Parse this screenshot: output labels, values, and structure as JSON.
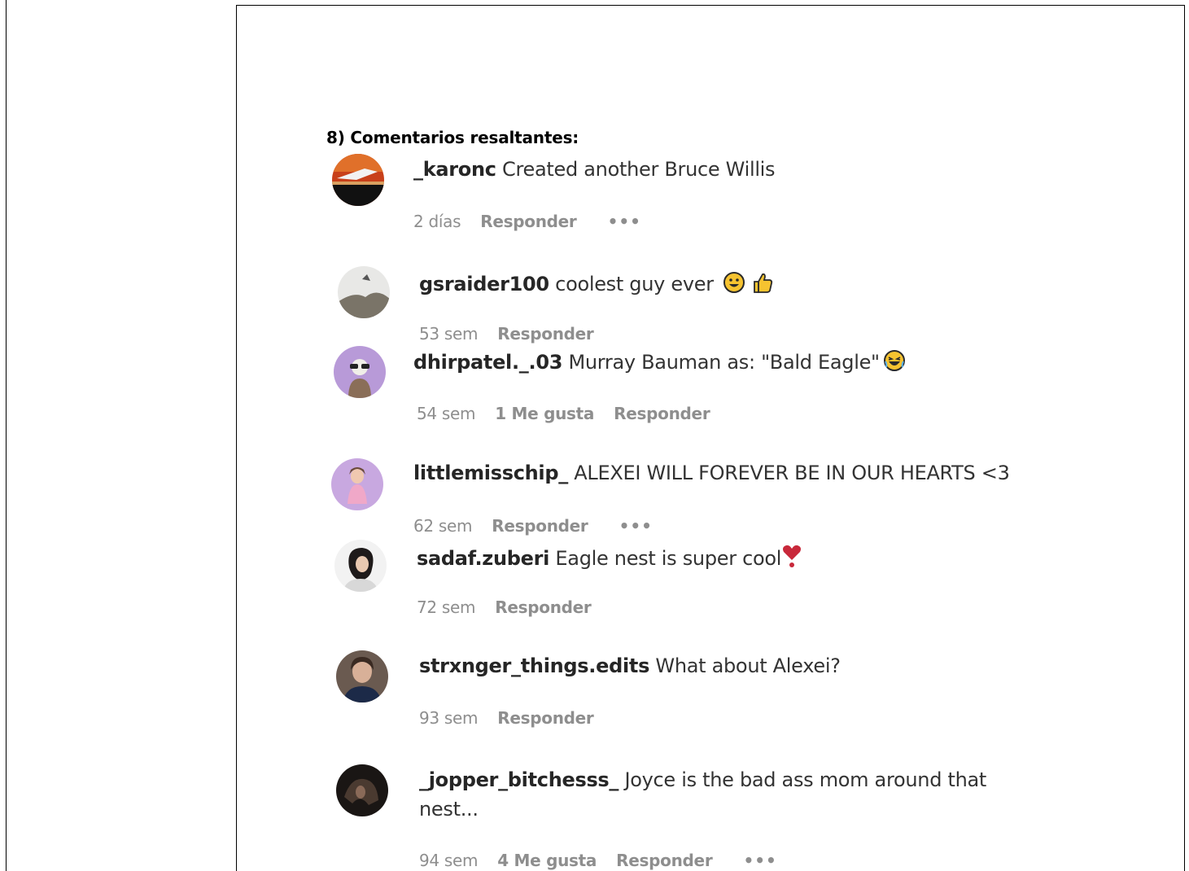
{
  "section": {
    "title": "8) Comentarios resaltantes:"
  },
  "colors": {
    "username": "#262626",
    "text": "#333333",
    "meta": "#8e8e8e",
    "border": "#000000"
  },
  "comments": [
    {
      "username": "_karonc",
      "text": "Created another Bruce Willis",
      "time": "2 días",
      "likes": "",
      "reply_label": "Responder",
      "more": "•••",
      "emojis": []
    },
    {
      "username": "gsraider100",
      "text": "coolest guy ever",
      "time": "53 sem",
      "likes": "",
      "reply_label": "Responder",
      "more": "",
      "emojis": [
        "smiley-emoji",
        "thumbs-up-emoji"
      ]
    },
    {
      "username": "dhirpatel._.03",
      "text": "Murray Bauman as: \"Bald Eagle\"",
      "time": "54 sem",
      "likes": "1 Me gusta",
      "reply_label": "Responder",
      "more": "",
      "emojis": [
        "laughing-emoji"
      ]
    },
    {
      "username": "littlemisschip_",
      "text": "ALEXEI WILL FOREVER BE IN OUR HEARTS <3",
      "time": "62 sem",
      "likes": "",
      "reply_label": "Responder",
      "more": "•••",
      "emojis": []
    },
    {
      "username": "sadaf.zuberi",
      "text": "Eagle nest is super cool",
      "time": "72 sem",
      "likes": "",
      "reply_label": "Responder",
      "more": "",
      "emojis": [
        "heart-exclamation-emoji"
      ]
    },
    {
      "username": "strxnger_things.edits",
      "text": "What about Alexei?",
      "time": "93 sem",
      "likes": "",
      "reply_label": "Responder",
      "more": "",
      "emojis": []
    },
    {
      "username": "_jopper_bitchesss_",
      "text": "Joyce is the bad ass mom around that nest...",
      "time": "94 sem",
      "likes": "4 Me gusta",
      "reply_label": "Responder",
      "more": "•••",
      "emojis": []
    }
  ]
}
